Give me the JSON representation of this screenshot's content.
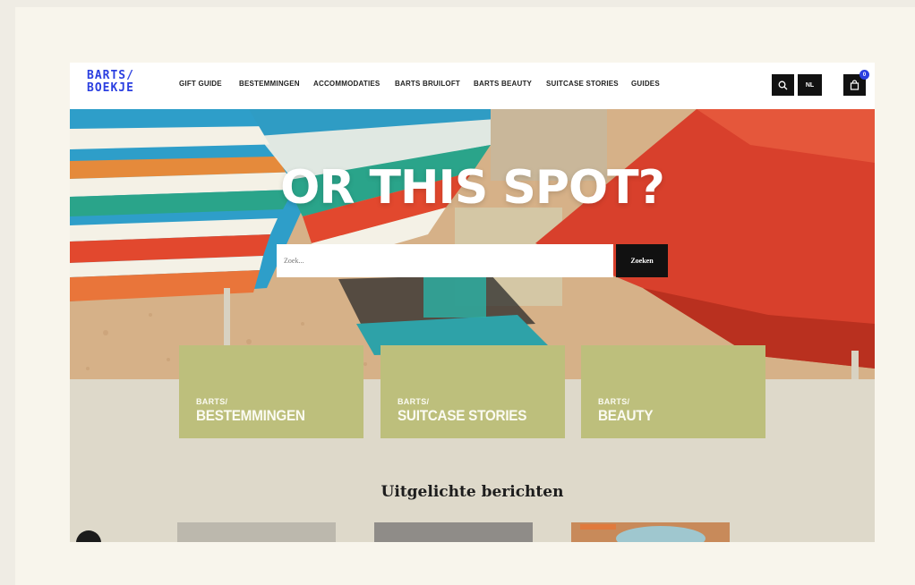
{
  "logo": {
    "line1": "BARTS/",
    "line2": "BOEKJE"
  },
  "nav": {
    "items": [
      {
        "label": "GIFT GUIDE"
      },
      {
        "label": "BESTEMMINGEN"
      },
      {
        "label": "ACCOMMODATIES"
      },
      {
        "label": "BARTS BRUILOFT"
      },
      {
        "label": "BARTS BEAUTY"
      },
      {
        "label": "SUITCASE STORIES"
      },
      {
        "label": "GUIDES"
      }
    ],
    "lang_label": "NL",
    "cart_count": "0",
    "search_icon": "search-icon",
    "cart_icon": "shopping-bag-icon"
  },
  "hero": {
    "title": "OR THIS SPOT?",
    "search_placeholder": "Zoek...",
    "search_button": "Zoeken"
  },
  "cards": [
    {
      "kicker": "BARTS/",
      "title": "BESTEMMINGEN"
    },
    {
      "kicker": "BARTS/",
      "title": "SUITCASE STORIES"
    },
    {
      "kicker": "BARTS/",
      "title": "BEAUTY"
    }
  ],
  "featured": {
    "title": "Uitgelichte berichten"
  },
  "colors": {
    "brand_blue": "#2b3fe0",
    "card_green": "#bdbf7c",
    "page_bg": "#ded9ca"
  }
}
